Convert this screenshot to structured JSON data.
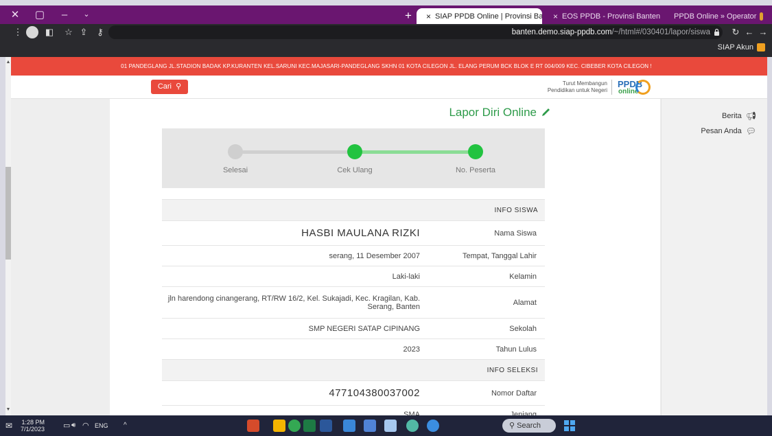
{
  "browser": {
    "tabs": [
      {
        "title": "PPDB Online » Operator",
        "active": false
      },
      {
        "title": "EOS PPDB - Provinsi Banten",
        "active": false
      },
      {
        "title": "SIAP PPDB Online | Provinsi Bant...",
        "active": true
      }
    ],
    "url_host": "banten.demo.siap-ppdb.com",
    "url_path": "/~/html#/030401/lapor/siswa",
    "bookmark": "SIAP Akun",
    "new_tab": "+",
    "close": "×"
  },
  "site": {
    "marquee": "01 PANDEGLANG JL.STADION BADAK KP.KURANTEN KEL.SARUNI KEC.MAJASARI-PANDEGLANG SKHN 01 KOTA CILEGON JL. ELANG PERUM BCK BLOK E RT 004/009 KEC. CIBEBER KOTA CILEGON !",
    "logo_top": "PPDB",
    "logo_bottom": "online",
    "tagline_1": "Turut Membangun",
    "tagline_2": "Pendidikan untuk Negeri",
    "search_button": "Cari"
  },
  "sidebar": {
    "items": [
      {
        "label": "Berita",
        "icon": "megaphone-icon"
      },
      {
        "label": "Pesan Anda",
        "icon": "chat-icon"
      }
    ]
  },
  "page": {
    "title": "Lapor Diri Online",
    "steps": [
      {
        "label": "No. Peserta",
        "done": true
      },
      {
        "label": "Cek Ulang",
        "done": true
      },
      {
        "label": "Selesai",
        "done": false
      }
    ],
    "sections": {
      "siswa": "INFO SISWA",
      "seleksi": "INFO SELEKSI"
    },
    "siswa_rows": [
      {
        "key": "Nama Siswa",
        "value": "HASBI MAULANA RIZKI",
        "big": true
      },
      {
        "key": "Tempat, Tanggal Lahir",
        "value": "serang, 11 Desember 2007"
      },
      {
        "key": "Kelamin",
        "value": "Laki-laki"
      },
      {
        "key": "Alamat",
        "value": "jln harendong cinangerang, RT/RW 16/2, Kel. Sukajadi, Kec. Kragilan, Kab. Serang, Banten"
      },
      {
        "key": "Sekolah",
        "value": "SMP NEGERI SATAP CIPINANG"
      },
      {
        "key": "Tahun Lulus",
        "value": "2023"
      }
    ],
    "seleksi_rows": [
      {
        "key": "Nomor Daftar",
        "value": "477104380037002",
        "big": true
      },
      {
        "key": "Jenjang",
        "value": "SMA"
      }
    ]
  },
  "taskbar": {
    "search": "Search",
    "lang": "ENG",
    "time": "1:28 PM",
    "date": "7/1/2023"
  },
  "colors": {
    "accent_red": "#e9493c",
    "accent_green": "#2e9b4a",
    "tab_purple": "#6a1670"
  }
}
